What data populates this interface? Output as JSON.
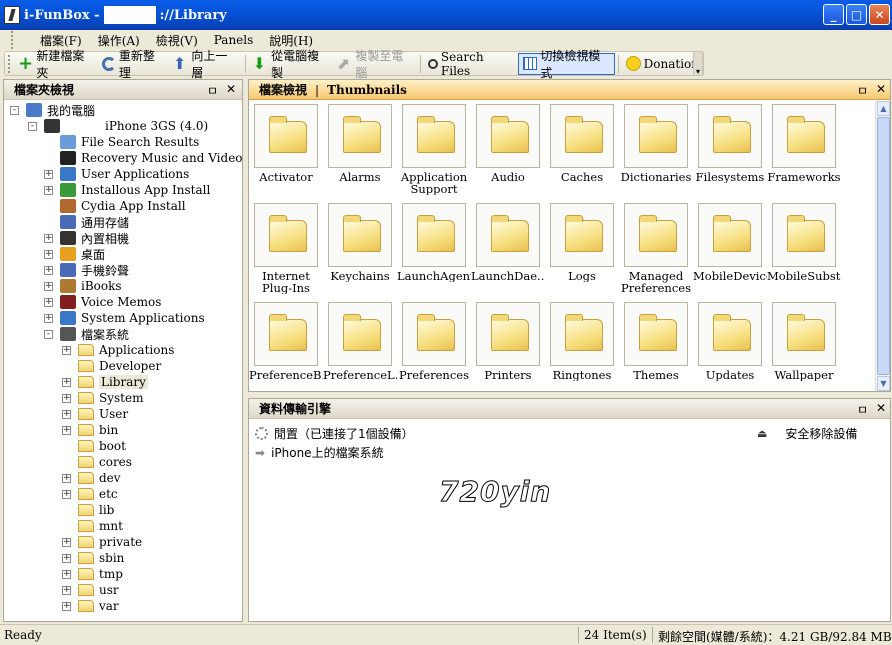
{
  "window": {
    "title_prefix": "i-FunBox - ",
    "title_suffix": "://Library",
    "buttons": {
      "min": "_",
      "max": "□",
      "close": "✕"
    }
  },
  "menu": [
    "檔案(F)",
    "操作(A)",
    "檢視(V)",
    "Panels",
    "說明(H)"
  ],
  "toolbar": {
    "new_folder": "新建檔案夾",
    "refresh": "重新整理",
    "up": "向上一層",
    "copy_from_pc": "從電腦複製",
    "copy_to_pc": "複製至電腦",
    "search": "Search Files",
    "switch_view": "切換檢視模式",
    "donation": "Donation"
  },
  "left_panel": {
    "title": "檔案夾檢視",
    "pin": "ㅁ",
    "close": "✕",
    "tree": [
      {
        "label": "我的電腦",
        "level": 0,
        "expander": "-",
        "icon": "computer-icon"
      },
      {
        "label": "iPhone 3GS (4.0)",
        "level": 1,
        "expander": "-",
        "icon": "iphone-icon"
      },
      {
        "label": "File Search Results",
        "level": 2,
        "expander": "",
        "icon": "search-results-icon"
      },
      {
        "label": "Recovery Music and Video",
        "level": 2,
        "expander": "",
        "icon": "film-icon"
      },
      {
        "label": "User Applications",
        "level": 2,
        "expander": "+",
        "icon": "apps-icon"
      },
      {
        "label": "Installous App Install",
        "level": 2,
        "expander": "+",
        "icon": "installous-icon"
      },
      {
        "label": "Cydia App Install",
        "level": 2,
        "expander": "",
        "icon": "cydia-icon"
      },
      {
        "label": "通用存儲",
        "level": 2,
        "expander": "",
        "icon": "storage-icon"
      },
      {
        "label": "內置相機",
        "level": 2,
        "expander": "+",
        "icon": "camera-icon"
      },
      {
        "label": "桌面",
        "level": 2,
        "expander": "+",
        "icon": "desktop-icon"
      },
      {
        "label": "手機鈴聲",
        "level": 2,
        "expander": "+",
        "icon": "ringtone-icon"
      },
      {
        "label": "iBooks",
        "level": 2,
        "expander": "+",
        "icon": "ibooks-icon"
      },
      {
        "label": "Voice Memos",
        "level": 2,
        "expander": "+",
        "icon": "voice-memo-icon"
      },
      {
        "label": "System Applications",
        "level": 2,
        "expander": "+",
        "icon": "system-apps-icon"
      },
      {
        "label": "檔案系統",
        "level": 2,
        "expander": "-",
        "icon": "filesystem-icon"
      },
      {
        "label": "Applications",
        "level": 3,
        "expander": "+",
        "icon": "folder-icon"
      },
      {
        "label": "Developer",
        "level": 3,
        "expander": "",
        "icon": "folder-icon"
      },
      {
        "label": "Library",
        "level": 3,
        "expander": "+",
        "icon": "folder-icon",
        "selected": true
      },
      {
        "label": "System",
        "level": 3,
        "expander": "+",
        "icon": "folder-icon"
      },
      {
        "label": "User",
        "level": 3,
        "expander": "+",
        "icon": "folder-icon"
      },
      {
        "label": "bin",
        "level": 3,
        "expander": "+",
        "icon": "folder-icon"
      },
      {
        "label": "boot",
        "level": 3,
        "expander": "",
        "icon": "folder-icon"
      },
      {
        "label": "cores",
        "level": 3,
        "expander": "",
        "icon": "folder-icon"
      },
      {
        "label": "dev",
        "level": 3,
        "expander": "+",
        "icon": "folder-icon"
      },
      {
        "label": "etc",
        "level": 3,
        "expander": "+",
        "icon": "folder-icon"
      },
      {
        "label": "lib",
        "level": 3,
        "expander": "",
        "icon": "folder-icon"
      },
      {
        "label": "mnt",
        "level": 3,
        "expander": "",
        "icon": "folder-icon"
      },
      {
        "label": "private",
        "level": 3,
        "expander": "+",
        "icon": "folder-icon"
      },
      {
        "label": "sbin",
        "level": 3,
        "expander": "+",
        "icon": "folder-icon"
      },
      {
        "label": "tmp",
        "level": 3,
        "expander": "+",
        "icon": "folder-icon"
      },
      {
        "label": "usr",
        "level": 3,
        "expander": "+",
        "icon": "folder-icon"
      },
      {
        "label": "var",
        "level": 3,
        "expander": "+",
        "icon": "folder-icon"
      }
    ]
  },
  "right_panel": {
    "title": "檔案檢視",
    "subtitle": "Thumbnails",
    "pin": "ㅁ",
    "close": "✕",
    "folders": [
      "Activator",
      "Alarms",
      "Application Support",
      "Audio",
      "Caches",
      "Dictionaries",
      "Filesystems",
      "Frameworks",
      "Internet Plug-Ins",
      "Keychains",
      "LaunchAgents",
      "LaunchDae...",
      "Logs",
      "Managed Preferences",
      "MobileDevice",
      "MobileSubst...",
      "PreferenceB...",
      "PreferenceL...",
      "Preferences",
      "Printers",
      "Ringtones",
      "Themes",
      "Updates",
      "Wallpaper"
    ]
  },
  "transfer_panel": {
    "title": "資料傳輸引擎",
    "pin": "ㅁ",
    "close": "✕",
    "status": "閒置（已連接了1個設備）",
    "safe_remove": "安全移除設備",
    "filesystem_item": "iPhone上的檔案系統",
    "watermark": "720yin"
  },
  "statusbar": {
    "ready": "Ready",
    "items": "24 Item(s)",
    "space": "剩餘空間(媒體/系統)：4.21 GB/92.84 MB"
  },
  "colors": {
    "title_blue": "#0454d8",
    "panel_orange": "#f8c870",
    "selection": "#316ac5"
  }
}
